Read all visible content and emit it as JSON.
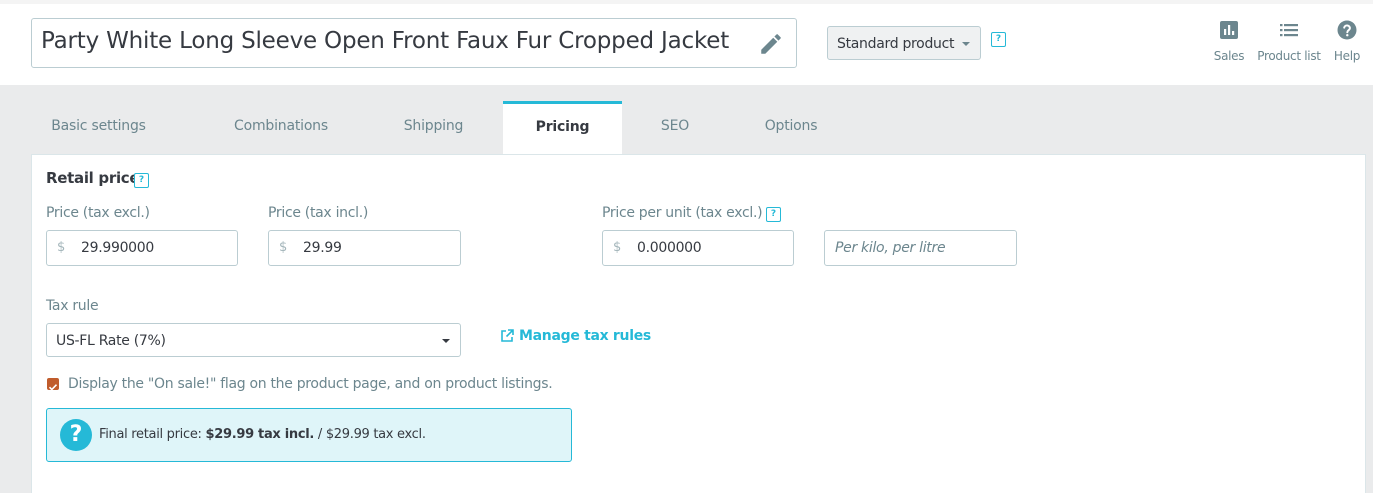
{
  "header": {
    "product_name": "Party White Long Sleeve Open Front Faux Fur Cropped Jacket",
    "product_type": "Standard product",
    "help_mark": "?",
    "toolbar": [
      {
        "label": "Sales",
        "icon": "bar-chart-icon"
      },
      {
        "label": "Product list",
        "icon": "list-icon"
      },
      {
        "label": "Help",
        "icon": "help-circle-icon"
      }
    ]
  },
  "tabs": [
    {
      "label": "Basic settings",
      "active": false
    },
    {
      "label": "Combinations",
      "active": false
    },
    {
      "label": "Shipping",
      "active": false
    },
    {
      "label": "Pricing",
      "active": true
    },
    {
      "label": "SEO",
      "active": false
    },
    {
      "label": "Options",
      "active": false
    }
  ],
  "pricing": {
    "section_title": "Retail price",
    "help_mark": "?",
    "currency_symbol": "$",
    "price_tax_excl": {
      "label": "Price (tax excl.)",
      "value": "29.990000"
    },
    "price_tax_incl": {
      "label": "Price (tax incl.)",
      "value": "29.99"
    },
    "price_per_unit": {
      "label": "Price per unit (tax excl.)",
      "value": "0.000000",
      "unit_placeholder": "Per kilo, per litre"
    },
    "tax_rule": {
      "label": "Tax rule",
      "selected": "US-FL Rate (7%)",
      "manage_link": "Manage tax rules"
    },
    "on_sale": {
      "checked": true,
      "label": "Display the \"On sale!\" flag on the product page, and on product listings."
    },
    "final": {
      "prefix": "Final retail price:",
      "incl": "$29.99 tax incl.",
      "excl": "/ $29.99 tax excl.",
      "icon_mark": "?"
    }
  },
  "colors": {
    "accent": "#25b9d7",
    "checkbox": "#c05c2c",
    "text": "#363a41",
    "muted": "#6c868e"
  }
}
